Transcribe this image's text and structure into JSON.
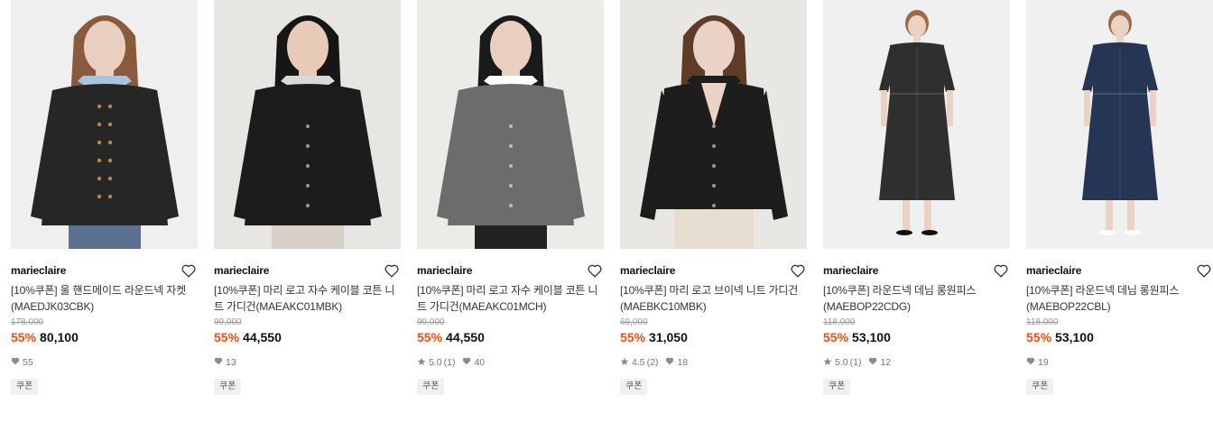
{
  "products": [
    {
      "brand": "marieclaire",
      "name": "[10%쿠폰] 울 핸드메이드 라운드넥 자켓(MAEDJK03CBK)",
      "original_price": "178,000",
      "discount": "55%",
      "price": "80,100",
      "rating": "",
      "likes": "55",
      "badge": "쿠폰",
      "image": {
        "bg": "#efefef",
        "garment": "#262626",
        "skin": "#e9cfc0",
        "hair": "#8a5a3c",
        "collar": "#a9c4df",
        "bottom": "#5b6f8e",
        "type": "jacket"
      }
    },
    {
      "brand": "marieclaire",
      "name": "[10%쿠폰] 마리 로고 자수 케이블 코튼 니트 가디건(MAEAKC01MBK)",
      "original_price": "99,000",
      "discount": "55%",
      "price": "44,550",
      "rating": "",
      "likes": "13",
      "badge": "쿠폰",
      "image": {
        "bg": "#e8e6e2",
        "garment": "#1c1c1c",
        "skin": "#e7cbb8",
        "hair": "#161616",
        "collar": "#d9d9d9",
        "bottom": "#d6d0c6",
        "type": "cardigan"
      }
    },
    {
      "brand": "marieclaire",
      "name": "[10%쿠폰] 마리 로고 자수 케이블 코튼 니트 가디건(MAEAKC01MCH)",
      "original_price": "99,000",
      "discount": "55%",
      "price": "44,550",
      "rating": "5.0",
      "review_count": "(1)",
      "likes": "40",
      "badge": "쿠폰",
      "image": {
        "bg": "#ecebe8",
        "garment": "#6c6c6c",
        "skin": "#e9cfbf",
        "hair": "#1a1a1a",
        "collar": "#ffffff",
        "bottom": "#222222",
        "type": "cardigan"
      }
    },
    {
      "brand": "marieclaire",
      "name": "[10%쿠폰] 마리 로고 브이넥 니트 가디건(MAEBKC10MBK)",
      "original_price": "69,000",
      "discount": "55%",
      "price": "31,050",
      "rating": "4.5",
      "review_count": "(2)",
      "likes": "18",
      "badge": "쿠폰",
      "image": {
        "bg": "#e9e7e4",
        "garment": "#1d1d1d",
        "skin": "#ead2c4",
        "hair": "#5e3c28",
        "collar": "#1d1d1d",
        "bottom": "#e6ddd0",
        "type": "vneck"
      }
    },
    {
      "brand": "marieclaire",
      "name": "[10%쿠폰] 라운드넥 데님 롱원피스 (MAEBOP22CDG)",
      "original_price": "118,000",
      "discount": "55%",
      "price": "53,100",
      "rating": "5.0",
      "review_count": "(1)",
      "likes": "12",
      "badge": "쿠폰",
      "image": {
        "bg": "#f0f0f0",
        "garment": "#2f2f2f",
        "skin": "#ead3c5",
        "hair": "#9a6b45",
        "collar": "#2f2f2f",
        "bottom": "#2f2f2f",
        "type": "dress"
      }
    },
    {
      "brand": "marieclaire",
      "name": "[10%쿠폰] 라운드넥 데님 롱원피스 (MAEBOP22CBL)",
      "original_price": "118,000",
      "discount": "55%",
      "price": "53,100",
      "rating": "",
      "likes": "19",
      "badge": "쿠폰",
      "image": {
        "bg": "#f0f0f0",
        "garment": "#243653",
        "skin": "#ead3c5",
        "hair": "#9a6b45",
        "collar": "#243653",
        "bottom": "#243653",
        "type": "dress"
      }
    }
  ],
  "colors": {
    "discount": "#ff4b11",
    "muted": "#9a9a9a",
    "badge_bg": "#f1f1f1"
  },
  "icons": {
    "wishlist": "heart-outline-icon",
    "likes": "heart-filled-icon",
    "rating": "star-icon"
  }
}
